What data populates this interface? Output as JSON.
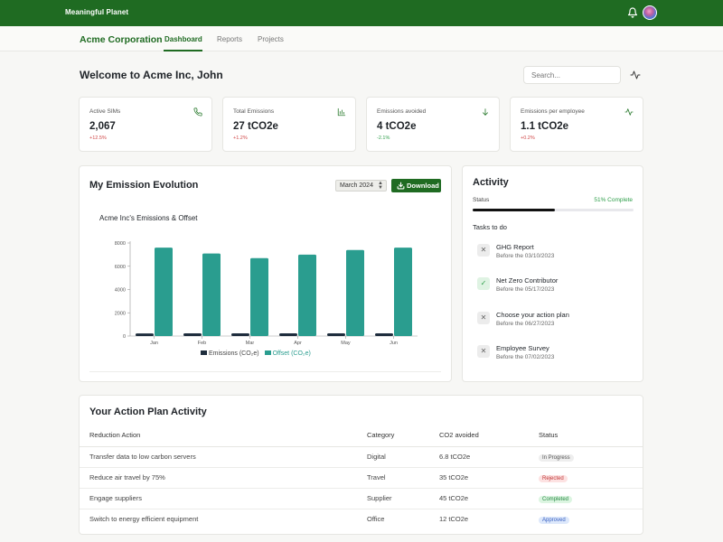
{
  "topbar": {
    "brand": "Meaningful Planet",
    "icons": [
      "bell-icon",
      "avatar"
    ],
    "color": "#1f6b22"
  },
  "subnav": {
    "company": "Acme Corporation",
    "tabs": [
      {
        "label": "Dashboard",
        "active": true
      },
      {
        "label": "Reports",
        "active": false
      },
      {
        "label": "Projects",
        "active": false
      }
    ]
  },
  "header": {
    "welcome": "Welcome to Acme Inc, John",
    "search_placeholder": "Search..."
  },
  "stats": [
    {
      "label": "Active SIMs",
      "value": "2,067",
      "delta": "+12.5%",
      "delta_color": "#d04848",
      "icon": "phone-icon"
    },
    {
      "label": "Total Emissions",
      "value": "27 tCO2e",
      "delta": "+1.2%",
      "delta_color": "#d04848",
      "icon": "chart-icon"
    },
    {
      "label": "Emissions avoided",
      "value": "4 tCO2e",
      "delta": "-2.1%",
      "delta_color": "#2e9e4a",
      "icon": "arrow-down-icon"
    },
    {
      "label": "Emissions per employee",
      "value": "1.1 tCO2e",
      "delta": "+0.2%",
      "delta_color": "#d04848",
      "icon": "activity-icon"
    }
  ],
  "evolution": {
    "title": "My Emission Evolution",
    "month": "March 2024",
    "download_label": "Download"
  },
  "chart_data": {
    "type": "bar",
    "title": "Acme Inc's Emissions & Offset",
    "categories": [
      "Jan",
      "Feb",
      "Mar",
      "Apr",
      "May",
      "Jun"
    ],
    "series": [
      {
        "name": "Emissions (CO₂e)",
        "color": "#1e2d3d",
        "values": [
          220,
          230,
          230,
          230,
          230,
          230
        ]
      },
      {
        "name": "Offset (CO₂e)",
        "color": "#2a9d8f",
        "values": [
          7600,
          7100,
          6700,
          7000,
          7400,
          7600
        ]
      }
    ],
    "ylim": [
      0,
      8000
    ],
    "yticks": [
      0,
      2000,
      4000,
      6000,
      8000
    ],
    "grid": false,
    "legend": "bottom"
  },
  "activity": {
    "title": "Activity",
    "status_label": "Status",
    "status_value": "51% Complete",
    "progress": 0.51,
    "tasks_label": "Tasks to do",
    "tasks": [
      {
        "name": "GHG Report",
        "due": "Before the 03/10/2023",
        "done": false
      },
      {
        "name": "Net Zero Contributor",
        "due": "Before the 05/17/2023",
        "done": true
      },
      {
        "name": "Choose your action plan",
        "due": "Before the 06/27/2023",
        "done": false
      },
      {
        "name": "Employee Survey",
        "due": "Before the 07/02/2023",
        "done": false
      }
    ]
  },
  "action_plan": {
    "title": "Your Action Plan Activity",
    "columns": [
      "Reduction Action",
      "Category",
      "CO2 avoided",
      "Status"
    ],
    "rows": [
      {
        "action": "Transfer data to low carbon servers",
        "category": "Digital",
        "co2": "6.8 tCO2e",
        "status": "In Progress",
        "bg": "#eeeeee",
        "fg": "#555555"
      },
      {
        "action": "Reduce air travel by 75%",
        "category": "Travel",
        "co2": "35 tCO2e",
        "status": "Rejected",
        "bg": "#fde2e2",
        "fg": "#c03a3a"
      },
      {
        "action": "Engage suppliers",
        "category": "Supplier",
        "co2": "45 tCO2e",
        "status": "Completed",
        "bg": "#dcf5e1",
        "fg": "#2a8a45"
      },
      {
        "action": "Switch to energy efficient equipment",
        "category": "Office",
        "co2": "12 tCO2e",
        "status": "Approved",
        "bg": "#dde8fb",
        "fg": "#3a62c2"
      }
    ]
  }
}
